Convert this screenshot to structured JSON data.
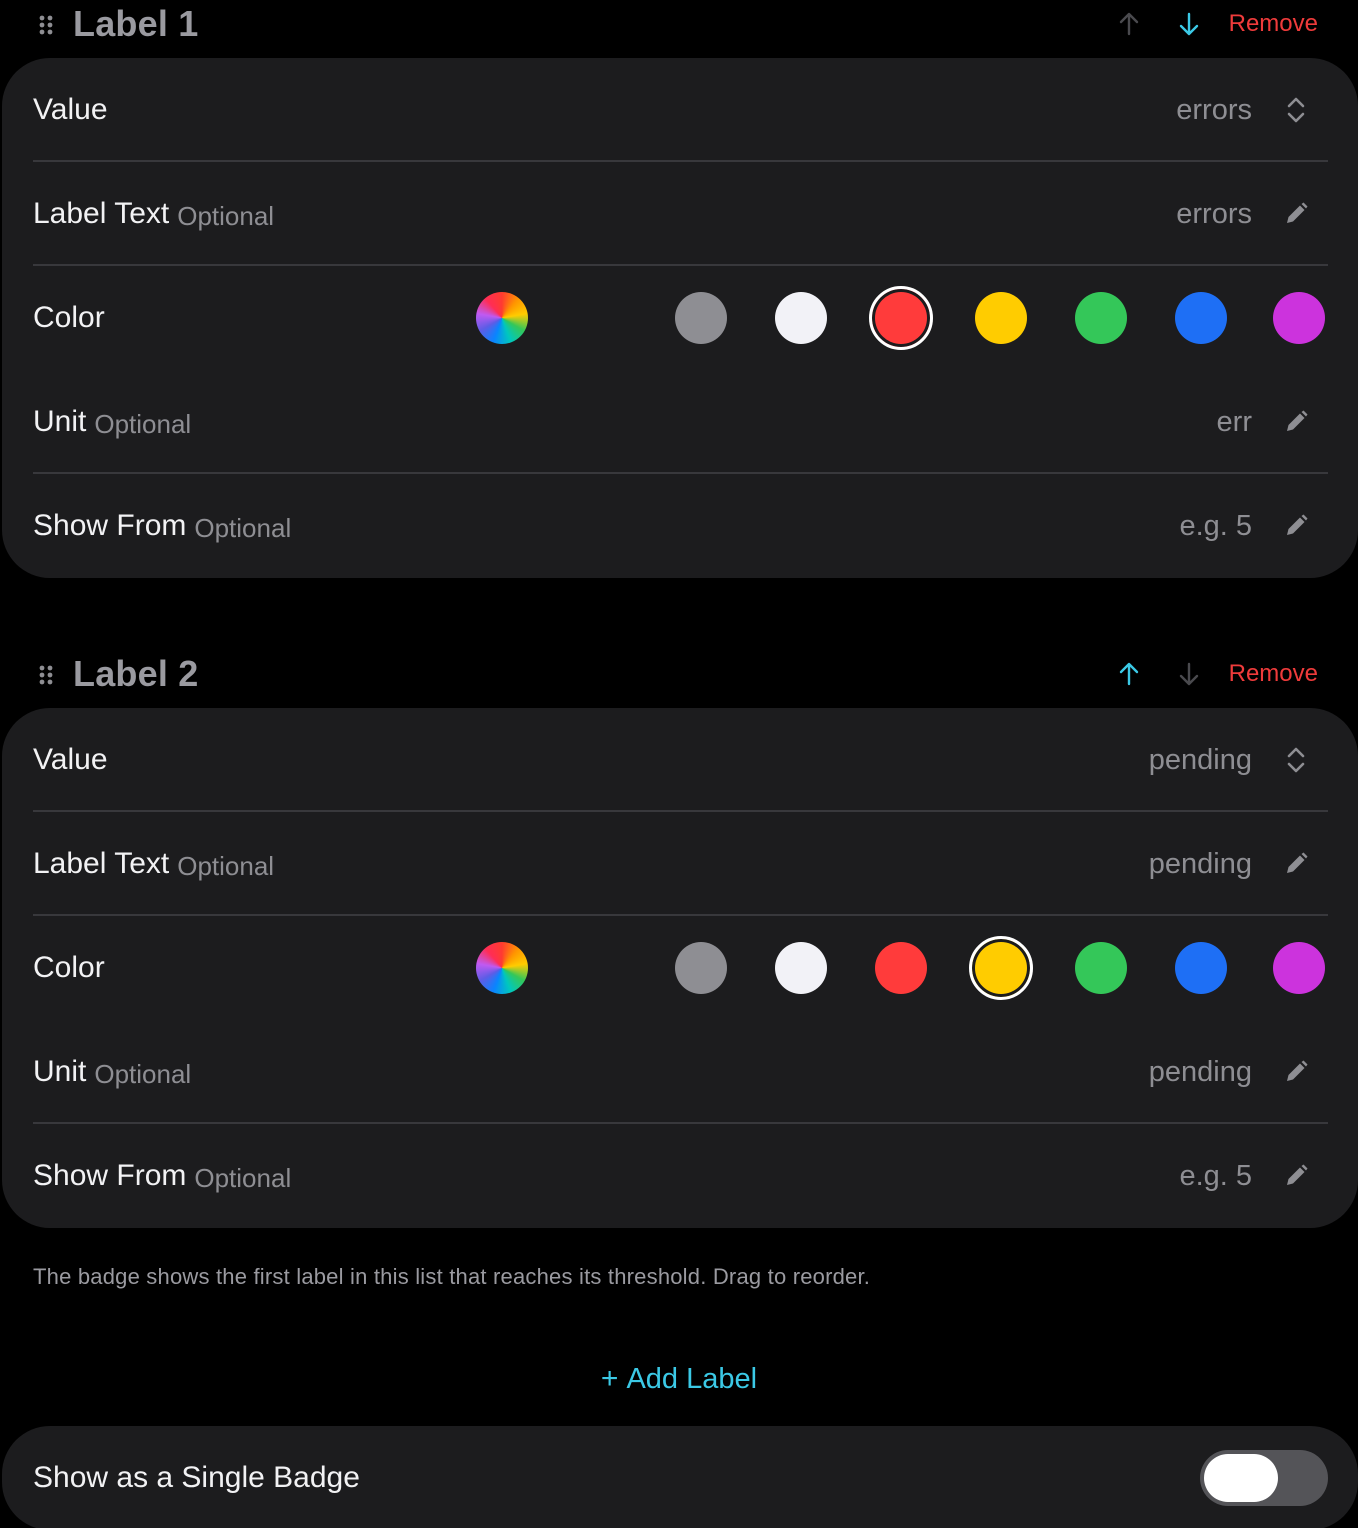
{
  "optional_tag": "Optional",
  "labels": [
    {
      "title": "Label 1",
      "remove": "Remove",
      "value_label": "Value",
      "value": "errors",
      "label_text_label": "Label Text",
      "label_text": "errors",
      "color_label": "Color",
      "selected_color": "red",
      "unit_label": "Unit",
      "unit": "err",
      "show_from_label": "Show From",
      "show_from_placeholder": "e.g. 5"
    },
    {
      "title": "Label 2",
      "remove": "Remove",
      "value_label": "Value",
      "value": "pending",
      "label_text_label": "Label Text",
      "label_text": "pending",
      "color_label": "Color",
      "selected_color": "yellow",
      "unit_label": "Unit",
      "unit": "pending",
      "show_from_label": "Show From",
      "show_from_placeholder": "e.g. 5"
    }
  ],
  "color_options": [
    {
      "name": "custom",
      "hex": "rainbow"
    },
    {
      "name": "gray",
      "hex": "#8e8e93"
    },
    {
      "name": "white",
      "hex": "#f2f2f7"
    },
    {
      "name": "red",
      "hex": "#ff3b3b"
    },
    {
      "name": "yellow",
      "hex": "#ffcc00"
    },
    {
      "name": "green",
      "hex": "#34c759"
    },
    {
      "name": "blue",
      "hex": "#1e6ff5"
    },
    {
      "name": "purple",
      "hex": "#cc33dd"
    }
  ],
  "colors": {
    "accent": "#3bc9e6",
    "destructive": "#ef3b3b",
    "card": "#1c1c1e",
    "background": "#000000"
  },
  "footnote": "The badge shows the first label in this list that reaches its threshold. Drag to reorder.",
  "add_label": "Add Label",
  "add_label_icon": "+",
  "single_badge": {
    "label": "Show as a Single Badge",
    "enabled": false
  }
}
